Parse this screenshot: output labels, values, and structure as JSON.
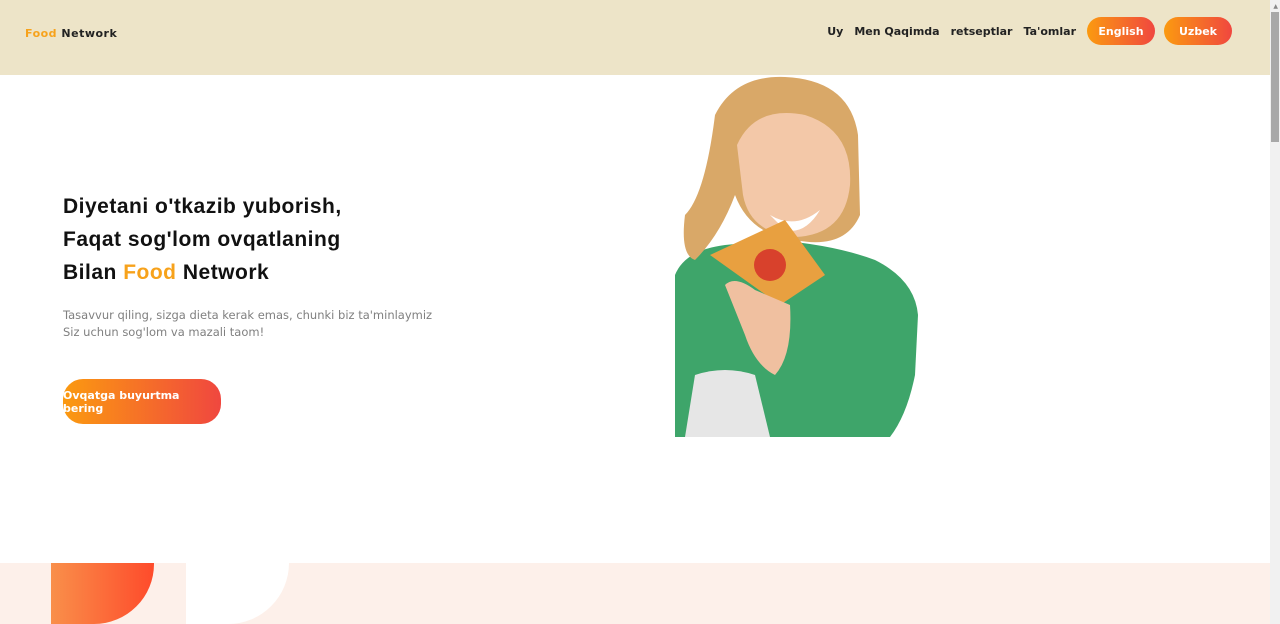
{
  "brand": {
    "part1": "Food",
    "part2": "Network"
  },
  "nav": {
    "items": [
      "Uy",
      "Men Qaqimda",
      "retseptlar",
      "Ta'omlar"
    ],
    "english": "English",
    "uzbek": "Uzbek"
  },
  "hero": {
    "line1": "Diyetani o'tkazib yuborish,",
    "line2": "Faqat sog'lom ovqatlaning",
    "line3_pre": "Bilan",
    "line3_hl": "Food",
    "line3_post": "Network",
    "sub1": "Tasavvur qiling, sizga dieta kerak emas, chunki biz ta'minlaymiz",
    "sub2": "Siz uchun sog'lom va mazali taom!",
    "cta": "Ovqatga buyurtma bering"
  },
  "colors": {
    "accent": "#f7a21b",
    "gradient_start": "#fb9a10",
    "gradient_end": "#f0473f",
    "header_bg": "#ede4c8"
  }
}
